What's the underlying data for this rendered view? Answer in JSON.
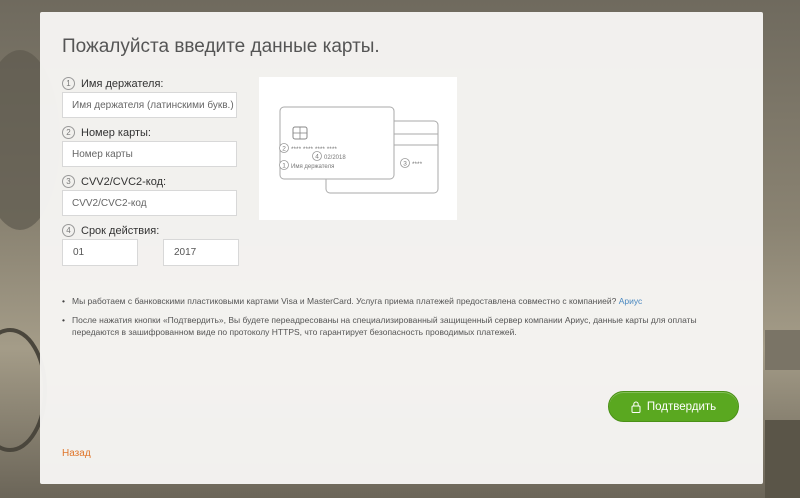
{
  "form": {
    "title": "Пожалуйста введите данные карты.",
    "fields": [
      {
        "num": "1",
        "label": "Имя держателя:",
        "placeholder": "Имя держателя (латинскими букв.)"
      },
      {
        "num": "2",
        "label": "Номер карты:",
        "placeholder": "Номер карты"
      },
      {
        "num": "3",
        "label": "CVV2/CVC2-код:",
        "placeholder": "CVV2/CVC2-код"
      },
      {
        "num": "4",
        "label": "Срок действия:"
      }
    ],
    "month_value": "01",
    "year_value": "2017"
  },
  "card_illustration": {
    "num2": "2",
    "number_mask": "**** **** **** ****",
    "num4": "4",
    "expiry": "02/2018",
    "num1": "1",
    "holder": "Имя держателя",
    "num3": "3",
    "cvv_mask": "****"
  },
  "info": {
    "bullet1_text": "Мы работаем с банковскими пластиковыми картами Visa и MasterCard. Услуга приема платежей предоставлена совместно с компанией",
    "bullet1_link": "Ариус",
    "bullet2_text": "После нажатия кнопки «Подтвердить», Вы будете переадресованы на специализированный защищенный сервер компании Ариус, данные карты для оплаты передаются в зашифрованном виде по протоколу HTTPS, что гарантирует безопасность проводимых платежей."
  },
  "actions": {
    "submit_label": "Подтвердить",
    "back_label": "Назад"
  },
  "colors": {
    "accent_green": "#5aa820",
    "link_blue": "#4a88c0",
    "back_orange": "#e0752a",
    "dropdown_arrow": "#e05a3a"
  }
}
